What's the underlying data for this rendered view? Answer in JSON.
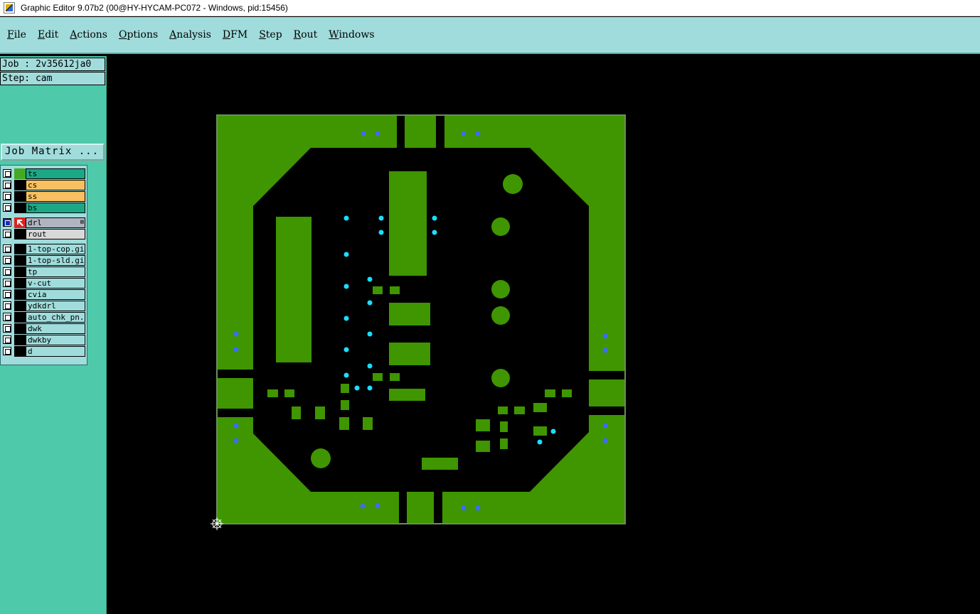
{
  "window": {
    "title": "Graphic Editor 9.07b2 (00@HY-HYCAM-PC072 - Windows, pid:15456)"
  },
  "menu": [
    {
      "ul": "F",
      "rest": "ile"
    },
    {
      "ul": "E",
      "rest": "dit"
    },
    {
      "ul": "A",
      "rest": "ctions"
    },
    {
      "ul": "O",
      "rest": "ptions"
    },
    {
      "ul": "A",
      "rest": "nalysis"
    },
    {
      "ul": "D",
      "rest": "FM"
    },
    {
      "ul": "S",
      "rest": "tep"
    },
    {
      "ul": "R",
      "rest": "out"
    },
    {
      "ul": "W",
      "rest": "indows"
    }
  ],
  "job": {
    "label": "Job : 2v35612ja0"
  },
  "step": {
    "label": "Step: cam"
  },
  "job_matrix": {
    "label": "Job Matrix ..."
  },
  "layers": [
    {
      "name": "ts",
      "color": "#1aa886",
      "swatch": "#44aa22"
    },
    {
      "name": "cs",
      "color": "#f8c060",
      "swatch": "#000000"
    },
    {
      "name": "ss",
      "color": "#f8c060",
      "swatch": "#000000"
    },
    {
      "name": "bs",
      "color": "#1aa886",
      "swatch": "#000000"
    },
    {
      "name": "drl",
      "color": "#b0b4c0",
      "swatch": "#e02020",
      "active": true,
      "mark": "⊞"
    },
    {
      "name": "rout",
      "color": "#d8d8d8",
      "swatch": "#000000"
    },
    {
      "name": "1-top-cop.gi",
      "color": "#a0dcdc",
      "swatch": "#000000"
    },
    {
      "name": "1-top-sld.gi",
      "color": "#a0dcdc",
      "swatch": "#000000"
    },
    {
      "name": "tp",
      "color": "#a0dcdc",
      "swatch": "#000000"
    },
    {
      "name": "v-cut",
      "color": "#a0dcdc",
      "swatch": "#000000"
    },
    {
      "name": "cvia",
      "color": "#a0dcdc",
      "swatch": "#000000"
    },
    {
      "name": "ydkdrl",
      "color": "#a0dcdc",
      "swatch": "#000000"
    },
    {
      "name": "auto_chk_pn.",
      "color": "#a0dcdc",
      "swatch": "#000000"
    },
    {
      "name": "dwk",
      "color": "#a0dcdc",
      "swatch": "#000000"
    },
    {
      "name": "dwkby",
      "color": "#a0dcdc",
      "swatch": "#000000"
    },
    {
      "name": "d",
      "color": "#a0dcdc",
      "swatch": "#000000"
    }
  ],
  "colors": {
    "menubar": "#a0dcdc",
    "sidebar": "#4ec9aa",
    "copper": "#3f9600",
    "drill_blue": "#3a6cff",
    "drill_cyan": "#19dfff"
  }
}
